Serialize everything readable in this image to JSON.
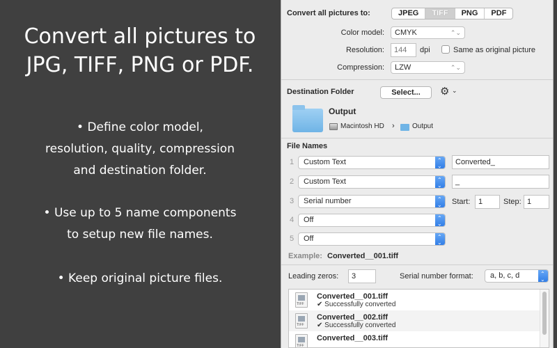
{
  "promo": {
    "headline_line1": "Convert all pictures to",
    "headline_line2": "JPG, TIFF, PNG or PDF.",
    "bullet1_line1": "• Define color model,",
    "bullet1_line2": "resolution, quality, compression",
    "bullet1_line3": "and destination folder.",
    "bullet2_line1": "• Use up to 5 name components",
    "bullet2_line2": "to setup new file names.",
    "bullet3": "• Keep original picture files."
  },
  "convert": {
    "label": "Convert all pictures to:",
    "formats": [
      "JPEG",
      "TIFF",
      "PNG",
      "PDF"
    ],
    "selected_format": "TIFF",
    "color_model_label": "Color model:",
    "color_model_value": "CMYK",
    "resolution_label": "Resolution:",
    "resolution_value": "144",
    "resolution_unit": "dpi",
    "same_as_original_label": "Same as original picture",
    "same_as_original_checked": false,
    "compression_label": "Compression:",
    "compression_value": "LZW"
  },
  "destination": {
    "title": "Destination Folder",
    "select_button": "Select...",
    "folder_name": "Output",
    "path_disk": "Macintosh HD",
    "path_sep": "›",
    "path_folder": "Output"
  },
  "file_names": {
    "title": "File Names",
    "rows": [
      {
        "num": "1",
        "type": "Custom Text",
        "value": "Converted_"
      },
      {
        "num": "2",
        "type": "Custom Text",
        "value": "_"
      },
      {
        "num": "3",
        "type": "Serial number",
        "start_label": "Start:",
        "start": "1",
        "step_label": "Step:",
        "step": "1"
      },
      {
        "num": "4",
        "type": "Off"
      },
      {
        "num": "5",
        "type": "Off"
      }
    ],
    "example_label": "Example:",
    "example_value": "Converted__001.tiff",
    "leading_zeros_label": "Leading zeros:",
    "leading_zeros_value": "3",
    "serial_format_label": "Serial number format:",
    "serial_format_value": "a, b, c, d"
  },
  "results": [
    {
      "name": "Converted__001.tiff",
      "status": "✔ Successfully converted"
    },
    {
      "name": "Converted__002.tiff",
      "status": "✔ Successfully converted"
    },
    {
      "name": "Converted__003.tiff",
      "status": ""
    }
  ],
  "colors": {
    "left_background": "#404040",
    "panel_background": "#ececec",
    "accent_blue": "#2f7ce6",
    "folder_blue": "#6fb4e6"
  }
}
